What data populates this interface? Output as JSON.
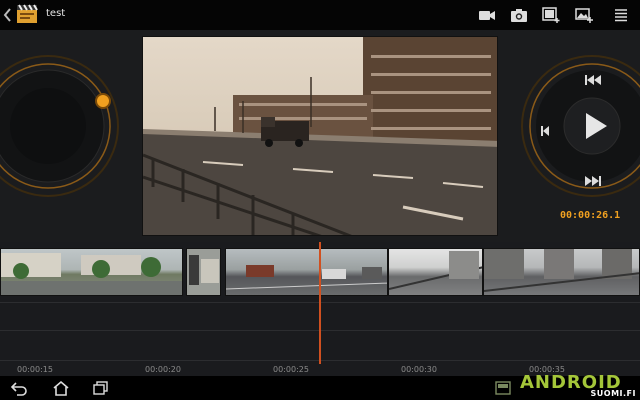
{
  "app": {
    "project_title": "test"
  },
  "player": {
    "timecode": "00:00:26.1"
  },
  "ruler": {
    "labels": [
      "00:00:15",
      "00:00:20",
      "00:00:25",
      "00:00:30",
      "00:00:35"
    ]
  },
  "watermark": {
    "brand": "ANDROID",
    "sub": "SUOMI.FI"
  },
  "colors": {
    "accent": "#f0a020",
    "playhead": "#d05020",
    "brand": "#a4c639"
  },
  "icons": {
    "toolbar": [
      "video-camera-icon",
      "photo-camera-icon",
      "add-media-icon",
      "add-image-icon",
      "menu-icon"
    ],
    "nav": [
      "back-icon",
      "home-icon",
      "recent-apps-icon"
    ]
  }
}
